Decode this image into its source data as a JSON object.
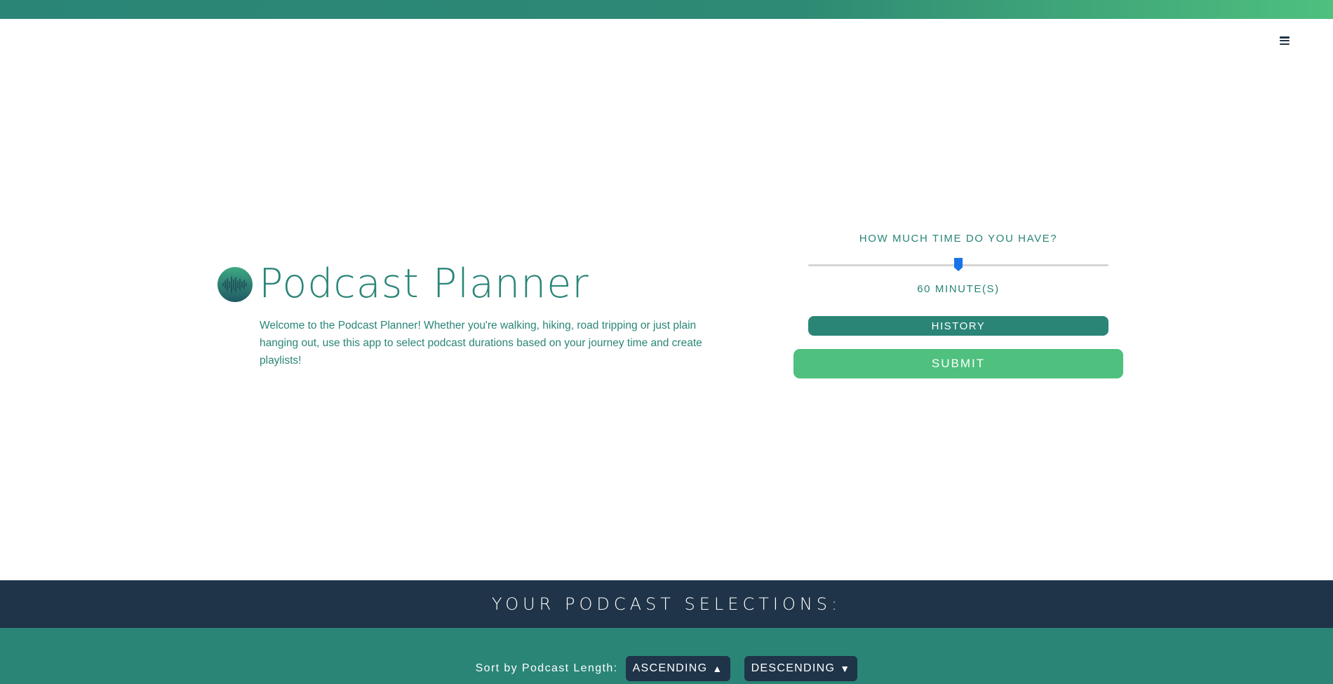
{
  "header": {
    "menu_icon": "hamburger-menu-icon"
  },
  "hero": {
    "logo_icon": "soundwave-icon",
    "title": "Podcast Planner",
    "intro": "Welcome to the Podcast Planner! Whether you're walking, hiking, road tripping or just plain hanging out, use this app to select podcast durations based on your journey time and create playlists!"
  },
  "time_panel": {
    "question": "HOW MUCH TIME DO YOU HAVE?",
    "slider_value_fraction": 0.5,
    "minutes_label": "60 MINUTE(S)",
    "history_label": "HISTORY",
    "submit_label": "SUBMIT"
  },
  "selections": {
    "title": "YOUR PODCAST SELECTIONS:",
    "sort_label": "Sort by Podcast Length:",
    "ascending_label": "ASCENDING",
    "ascending_arrow": "▲",
    "descending_label": "DESCENDING",
    "descending_arrow": "▼"
  },
  "colors": {
    "teal": "#2a8577",
    "green": "#4fc07e",
    "navy": "#1f3448",
    "slider_thumb": "#1a73e8"
  }
}
